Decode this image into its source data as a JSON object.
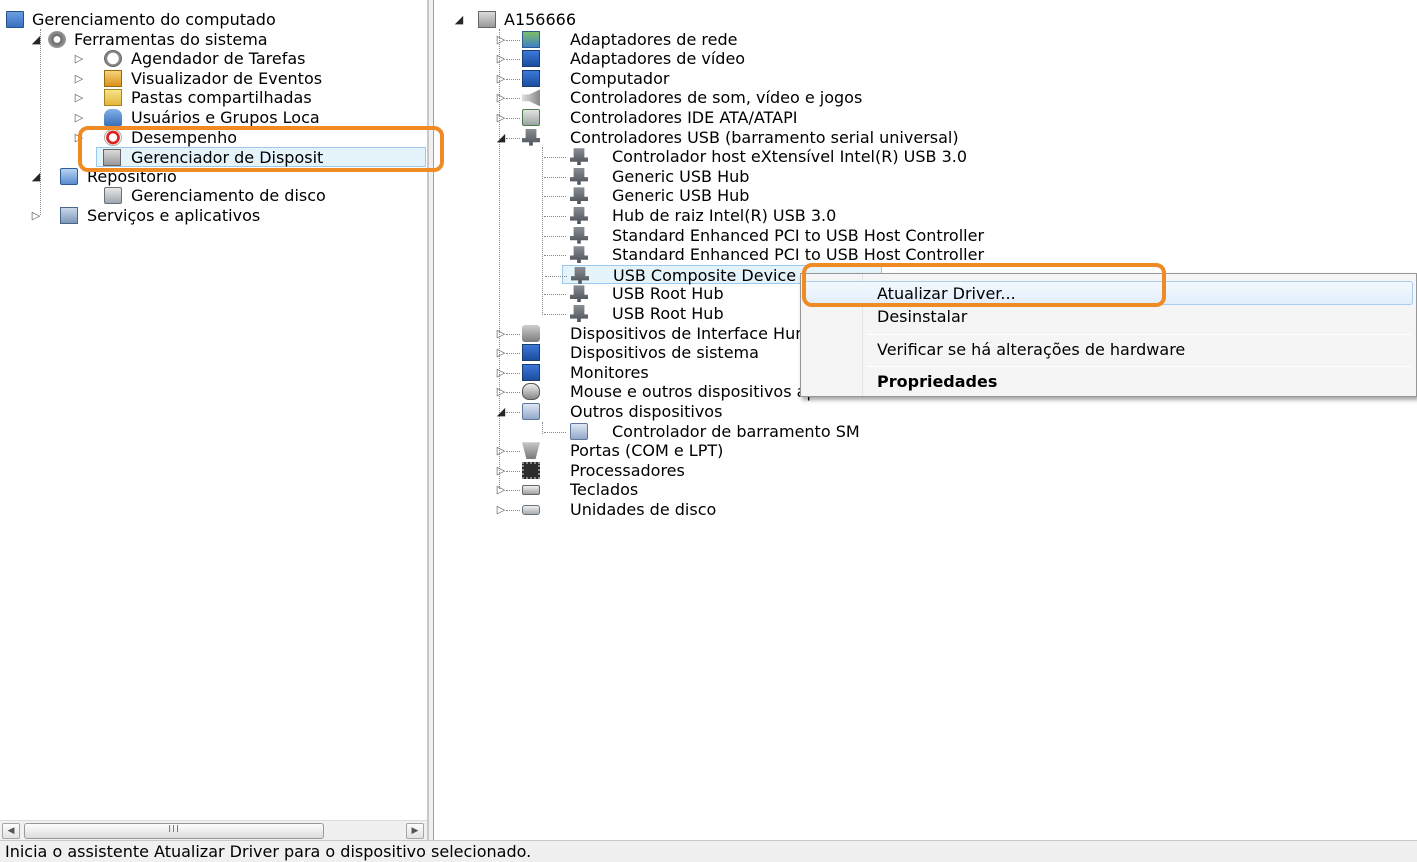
{
  "left_tree": {
    "root": {
      "label": "Gerenciamento do computado",
      "icon": "computer-management-icon"
    },
    "tools": {
      "label": "Ferramentas do sistema",
      "icon": "system-tools-icon"
    },
    "task_scheduler": {
      "label": "Agendador de Tarefas",
      "icon": "clock-icon"
    },
    "event_viewer": {
      "label": "Visualizador de Eventos",
      "icon": "event-log-icon"
    },
    "shared_folders": {
      "label": "Pastas compartilhadas",
      "icon": "shared-folder-icon"
    },
    "users_groups": {
      "label": "Usuários e Grupos Loca",
      "icon": "users-icon"
    },
    "performance": {
      "label": "Desempenho",
      "icon": "performance-icon"
    },
    "device_manager": {
      "label": "Gerenciador de Disposit",
      "icon": "device-manager-icon"
    },
    "storage": {
      "label": "Repositório",
      "icon": "storage-icon"
    },
    "disk_management": {
      "label": "Gerenciamento de disco",
      "icon": "disk-icon"
    },
    "services_apps": {
      "label": "Serviços e aplicativos",
      "icon": "services-icon"
    }
  },
  "right_tree": {
    "root": {
      "label": "A156666",
      "icon": "computer-icon"
    },
    "categories": [
      {
        "label": "Adaptadores de rede",
        "icon": "network-adapter-icon"
      },
      {
        "label": "Adaptadores de vídeo",
        "icon": "display-adapter-icon"
      },
      {
        "label": "Computador",
        "icon": "computer-icon"
      },
      {
        "label": "Controladores de som, vídeo e jogos",
        "icon": "speaker-icon"
      },
      {
        "label": "Controladores IDE ATA/ATAPI",
        "icon": "ide-controller-icon"
      },
      {
        "label": "Controladores USB (barramento serial universal)",
        "icon": "usb-icon"
      }
    ],
    "usb_children": [
      {
        "label": "Controlador host eXtensível Intel(R) USB 3.0"
      },
      {
        "label": "Generic USB Hub"
      },
      {
        "label": "Generic USB Hub"
      },
      {
        "label": "Hub de raiz Intel(R) USB 3.0"
      },
      {
        "label": "Standard Enhanced PCI to USB Host Controller"
      },
      {
        "label": "Standard Enhanced PCI to USB Host Controller"
      },
      {
        "label": "USB Composite Device"
      },
      {
        "label": "USB Root Hub"
      },
      {
        "label": "USB Root Hub"
      }
    ],
    "more_categories": [
      {
        "label": "Dispositivos de Interface Humana",
        "icon": "hid-icon"
      },
      {
        "label": "Dispositivos de sistema",
        "icon": "system-devices-icon"
      },
      {
        "label": "Monitores",
        "icon": "monitor-icon"
      },
      {
        "label": "Mouse e outros dispositivos apontadores",
        "icon": "mouse-icon"
      },
      {
        "label": "Outros dispositivos",
        "icon": "other-devices-icon"
      }
    ],
    "other_children": [
      {
        "label": "Controlador de barramento SM",
        "icon": "warning-device-icon"
      }
    ],
    "last_categories": [
      {
        "label": "Portas (COM e LPT)",
        "icon": "port-icon"
      },
      {
        "label": "Processadores",
        "icon": "processor-icon"
      },
      {
        "label": "Teclados",
        "icon": "keyboard-icon"
      },
      {
        "label": "Unidades de disco",
        "icon": "disk-drive-icon"
      }
    ]
  },
  "context_menu": {
    "update_driver": "Atualizar Driver...",
    "uninstall": "Desinstalar",
    "scan_hardware": "Verificar se há alterações de hardware",
    "properties": "Propriedades"
  },
  "scrollbar": {
    "left_arrow": "◀",
    "right_arrow": "▶",
    "grip": "III"
  },
  "statusbar": {
    "text": "Inicia o assistente Atualizar Driver para o dispositivo selecionado."
  },
  "colors": {
    "annotation": "#f08a24",
    "selection": "#e5f3fb",
    "menu_highlight": "#e2eefb"
  }
}
